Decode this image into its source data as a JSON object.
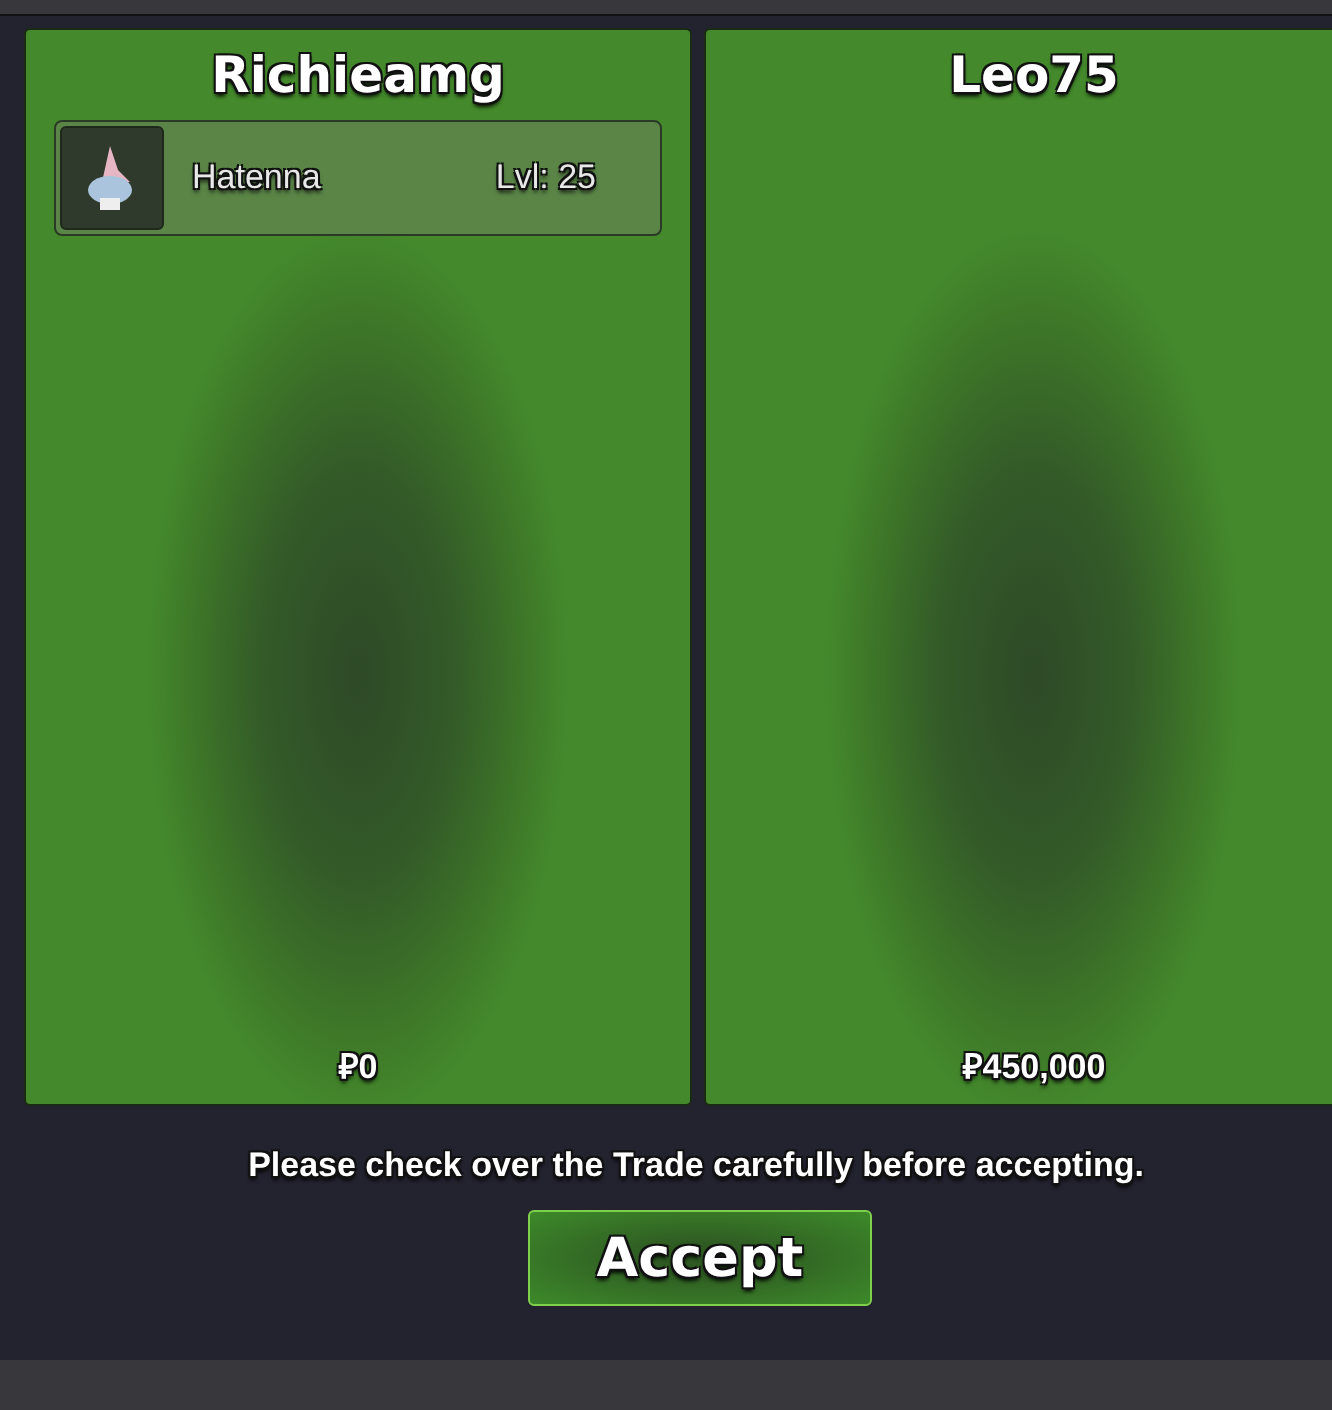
{
  "players": [
    {
      "name": "Richieamg",
      "pokemon": [
        {
          "name": "Hatenna",
          "level": "Lvl: 25"
        }
      ],
      "money": "₽0"
    },
    {
      "name": "Leo75",
      "money": "₽450,000"
    }
  ],
  "notice": "Please check over the Trade carefully before accepting.",
  "button": "Accept"
}
